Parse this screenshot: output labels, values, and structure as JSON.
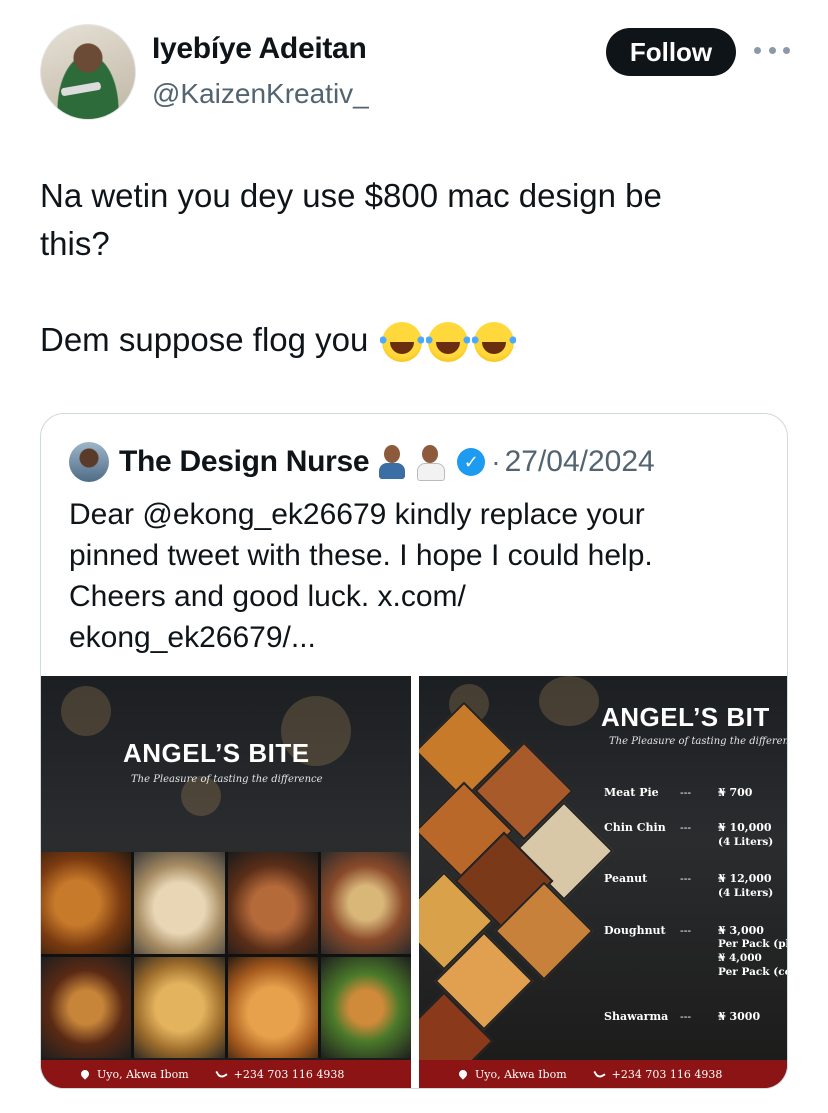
{
  "author": {
    "name": "Iyebíye Adeitan",
    "handle": "@KaizenKreativ_",
    "follow_label": "Follow"
  },
  "tweet": {
    "line1": "Na wetin you dey use $800 mac design be",
    "line2": "this?",
    "line3": "Dem suppose flog you",
    "emoji": [
      "face-with-tears-of-joy",
      "face-with-tears-of-joy",
      "face-with-tears-of-joy"
    ]
  },
  "quoted": {
    "name": "The Design Nurse",
    "name_emoji": [
      "man-technologist",
      "man-health-worker"
    ],
    "verified": true,
    "separator": "·",
    "date": "27/04/2024",
    "text_lines": [
      "Dear @ekong_ek26679 kindly replace your",
      "pinned tweet with these. I hope I could help.",
      "Cheers and good luck. x.com/",
      "ekong_ek26679/..."
    ]
  },
  "media": [
    {
      "brand": "ANGEL’S BITE",
      "tagline": "The Pleasure of tasting the difference",
      "location": "Uyo, Akwa Ibom",
      "phone": "+234 703 116 4938"
    },
    {
      "brand": "ANGEL’S BIT",
      "tagline": "The Pleasure of tasting the differen",
      "location": "Uyo, Akwa Ibom",
      "phone": "+234 703 116 4938",
      "menu": [
        {
          "item": "Meat Pie",
          "dash": "---",
          "price": "₦ 700",
          "sub": []
        },
        {
          "item": "Chin Chin",
          "dash": "---",
          "price": "₦ 10,000",
          "sub": [
            "(4 Liters)"
          ]
        },
        {
          "item": "Peanut",
          "dash": "---",
          "price": "₦ 12,000",
          "sub": [
            "(4 Liters)"
          ]
        },
        {
          "item": "Doughnut",
          "dash": "---",
          "price": "₦ 3,000",
          "sub": [
            "Per Pack (pla",
            "₦ 4,000",
            "Per Pack (coa"
          ]
        },
        {
          "item": "Shawarma",
          "dash": "---",
          "price": "₦ 3000",
          "sub": []
        }
      ]
    }
  ],
  "colors": {
    "text": "#0f1419",
    "muted": "#536471",
    "follow_bg": "#0f1419",
    "verified": "#1d9bf0",
    "footer_red": "#8c1414"
  }
}
